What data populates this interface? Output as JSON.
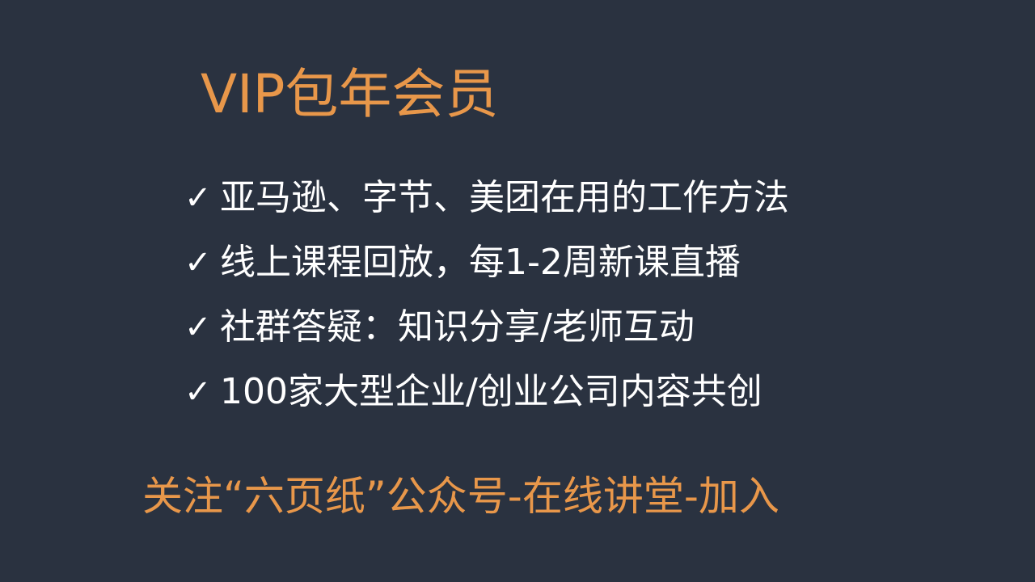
{
  "slide": {
    "title": "VIP包年会员",
    "check_glyph": "✓",
    "features": [
      "亚马逊、字节、美团在用的工作方法",
      "线上课程回放，每1-2周新课直播",
      "社群答疑：知识分享/老师互动",
      "100家大型企业/创业公司内容共创"
    ],
    "footer": "关注“六页纸”公众号-在线讲堂-加入"
  },
  "colors": {
    "background": "#2a3240",
    "accent": "#e8974a",
    "text": "#ffffff"
  }
}
